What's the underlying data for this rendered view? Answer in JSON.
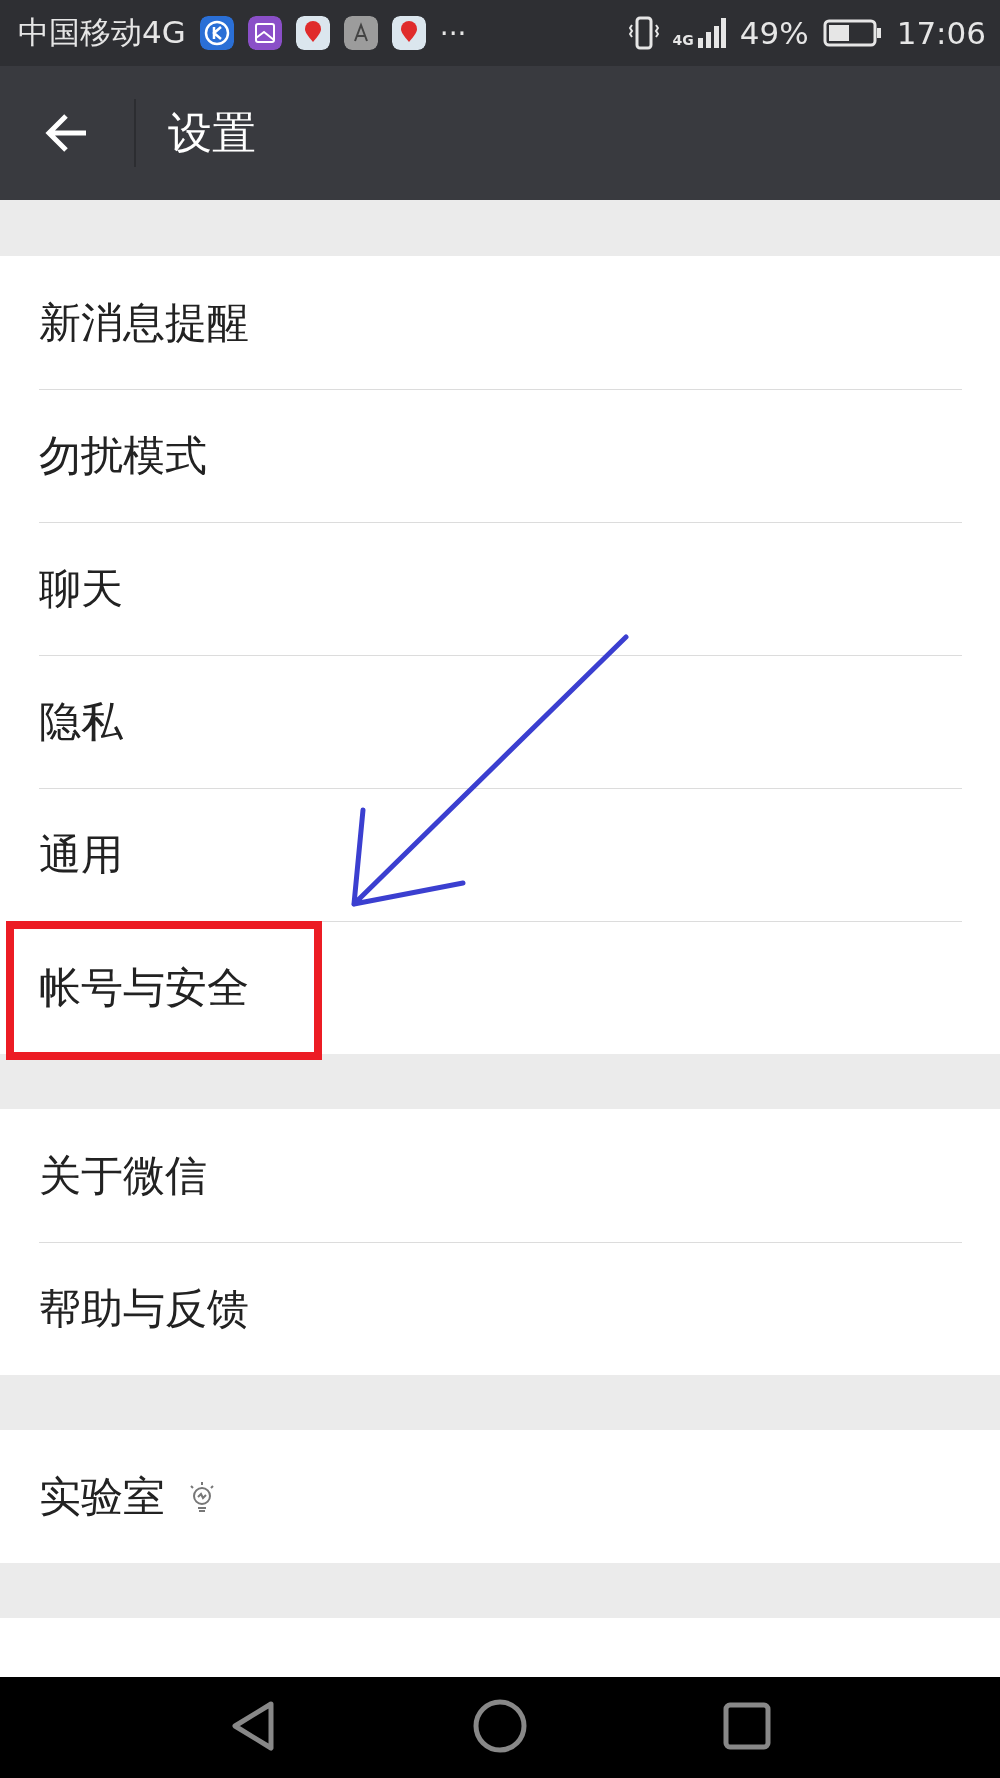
{
  "status_bar": {
    "carrier": "中国移动4G",
    "more": "···",
    "network": "4G",
    "battery_text": "49%",
    "time": "17:06"
  },
  "app_bar": {
    "title": "设置"
  },
  "sections": [
    {
      "items": [
        {
          "label": "新消息提醒",
          "kind": "plain",
          "highlighted": false
        },
        {
          "label": "勿扰模式",
          "kind": "plain",
          "highlighted": false
        },
        {
          "label": "聊天",
          "kind": "plain",
          "highlighted": false
        },
        {
          "label": "隐私",
          "kind": "plain",
          "highlighted": false
        },
        {
          "label": "通用",
          "kind": "plain",
          "highlighted": false
        },
        {
          "label": "帐号与安全",
          "kind": "plain",
          "highlighted": true
        }
      ]
    },
    {
      "items": [
        {
          "label": "关于微信",
          "kind": "plain",
          "highlighted": false
        },
        {
          "label": "帮助与反馈",
          "kind": "plain",
          "highlighted": false
        }
      ]
    },
    {
      "items": [
        {
          "label": "实验室",
          "kind": "lab",
          "highlighted": false
        }
      ]
    }
  ]
}
